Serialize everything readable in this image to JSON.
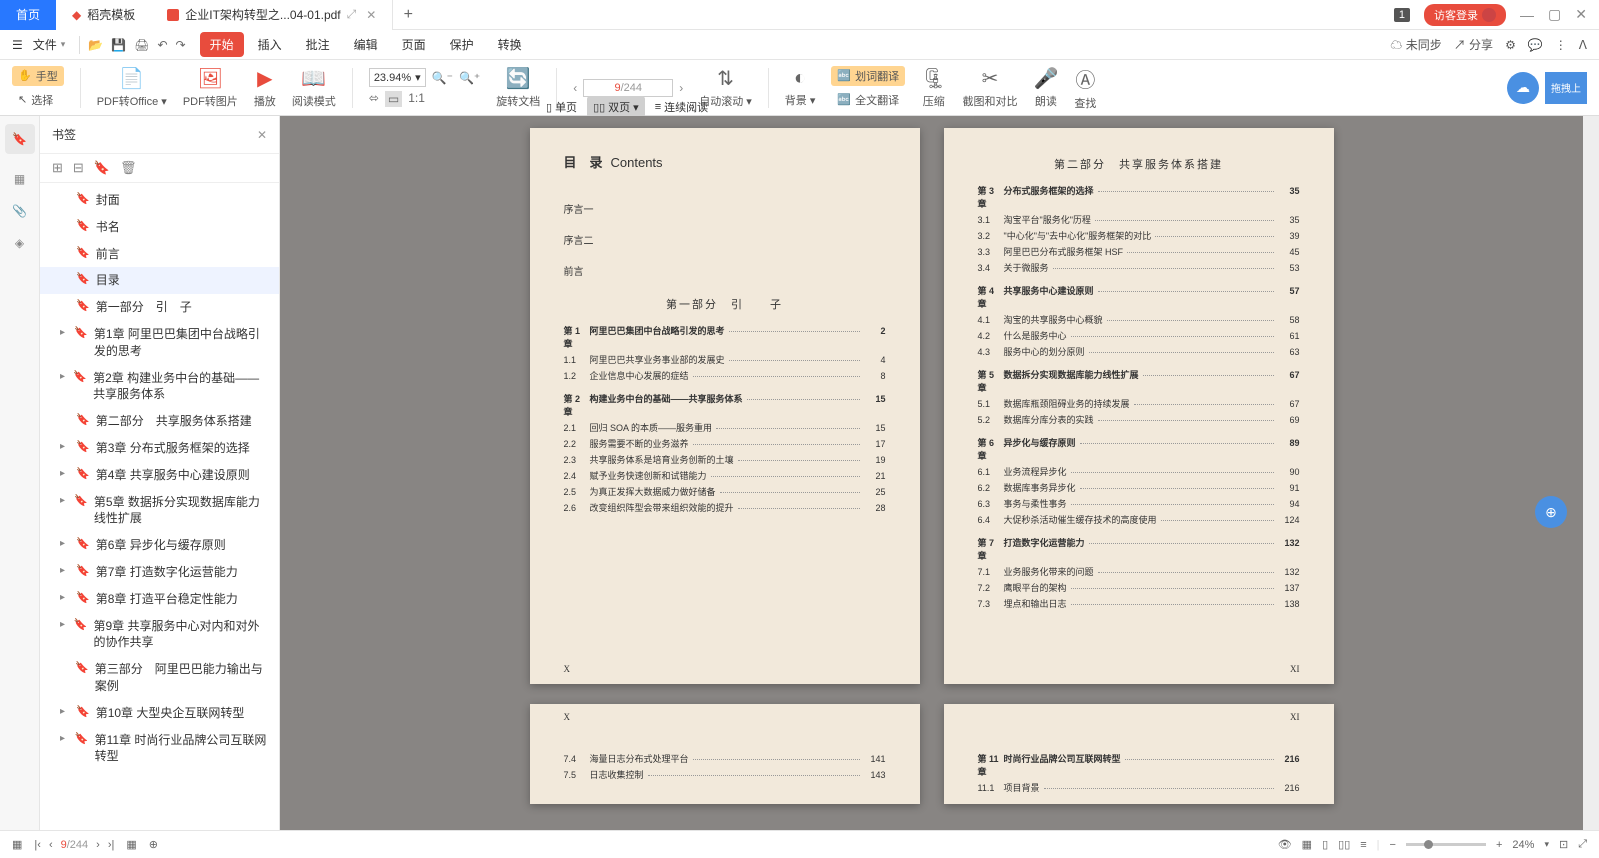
{
  "tabs": {
    "home": "首页",
    "template": "稻壳模板",
    "doc": "企业IT架构转型之...04-01.pdf"
  },
  "title_right": {
    "badge": "1",
    "login": "访客登录"
  },
  "menu": {
    "file": "文件",
    "tabs": [
      "开始",
      "插入",
      "批注",
      "编辑",
      "页面",
      "保护",
      "转换"
    ],
    "sync": "未同步",
    "share": "分享"
  },
  "ribbon": {
    "hand": "手型",
    "select": "选择",
    "pdf2office": "PDF转Office",
    "pdf2img": "PDF转图片",
    "play": "播放",
    "readmode": "阅读模式",
    "zoom": "23.94%",
    "rotate": "旋转文档",
    "single": "单页",
    "double": "双页",
    "continuous": "连续阅读",
    "autoscroll": "自动滚动",
    "bg": "背景",
    "seltrans": "划词翻译",
    "fulltrans": "全文翻译",
    "compress": "压缩",
    "crop": "截图和对比",
    "read": "朗读",
    "find": "查找",
    "curpage": "9",
    "totalpage": "/244",
    "drag": "拖拽上"
  },
  "sidebar": {
    "title": "书签",
    "items": [
      {
        "t": "封面",
        "l": 1
      },
      {
        "t": "书名",
        "l": 1
      },
      {
        "t": "前言",
        "l": 1
      },
      {
        "t": "目录",
        "l": 1,
        "active": true
      },
      {
        "t": "第一部分　引　子",
        "l": 1
      },
      {
        "t": "第1章 阿里巴巴集团中台战略引发的思考",
        "l": 2,
        "a": true
      },
      {
        "t": "第2章 构建业务中台的基础——共享服务体系",
        "l": 2,
        "a": true
      },
      {
        "t": "第二部分　共享服务体系搭建",
        "l": 1
      },
      {
        "t": "第3章 分布式服务框架的选择",
        "l": 2,
        "a": true
      },
      {
        "t": "第4章 共享服务中心建设原则",
        "l": 2,
        "a": true
      },
      {
        "t": "第5章 数据拆分实现数据库能力线性扩展",
        "l": 2,
        "a": true
      },
      {
        "t": "第6章 异步化与缓存原则",
        "l": 2,
        "a": true
      },
      {
        "t": "第7章 打造数字化运营能力",
        "l": 2,
        "a": true
      },
      {
        "t": "第8章 打造平台稳定性能力",
        "l": 2,
        "a": true
      },
      {
        "t": "第9章 共享服务中心对内和对外的协作共享",
        "l": 2,
        "a": true
      },
      {
        "t": "第三部分　阿里巴巴能力输出与案例",
        "l": 1
      },
      {
        "t": "第10章 大型央企互联网转型",
        "l": 2,
        "a": true
      },
      {
        "t": "第11章 时尚行业品牌公司互联网转型",
        "l": 2,
        "a": true
      }
    ]
  },
  "toc_left": {
    "title": "目　录",
    "title_en": "Contents",
    "pre": [
      "序言一",
      "序言二",
      "前言"
    ],
    "part": "第一部分　引　　子",
    "lines": [
      {
        "ch": true,
        "n": "第 1 章",
        "t": "阿里巴巴集团中台战略引发的思考",
        "p": "2"
      },
      {
        "n": "1.1",
        "t": "阿里巴巴共享业务事业部的发展史",
        "p": "4"
      },
      {
        "n": "1.2",
        "t": "企业信息中心发展的症结",
        "p": "8"
      },
      {
        "ch": true,
        "n": "第 2 章",
        "t": "构建业务中台的基础——共享服务体系",
        "p": "15"
      },
      {
        "n": "2.1",
        "t": "回归 SOA 的本质——服务重用",
        "p": "15"
      },
      {
        "n": "2.2",
        "t": "服务需要不断的业务滋养",
        "p": "17"
      },
      {
        "n": "2.3",
        "t": "共享服务体系是培育业务创新的土壤",
        "p": "19"
      },
      {
        "n": "2.4",
        "t": "赋予业务快速创新和试错能力",
        "p": "21"
      },
      {
        "n": "2.5",
        "t": "为真正发挥大数据威力做好储备",
        "p": "25"
      },
      {
        "n": "2.6",
        "t": "改变组织阵型会带来组织效能的提升",
        "p": "28"
      }
    ],
    "pgn": "X"
  },
  "toc_right": {
    "part": "第二部分　共享服务体系搭建",
    "lines": [
      {
        "ch": true,
        "n": "第 3 章",
        "t": "分布式服务框架的选择",
        "p": "35"
      },
      {
        "n": "3.1",
        "t": "淘宝平台\"服务化\"历程",
        "p": "35"
      },
      {
        "n": "3.2",
        "t": "\"中心化\"与\"去中心化\"服务框架的对比",
        "p": "39"
      },
      {
        "n": "3.3",
        "t": "阿里巴巴分布式服务框架 HSF",
        "p": "45"
      },
      {
        "n": "3.4",
        "t": "关于微服务",
        "p": "53"
      },
      {
        "ch": true,
        "n": "第 4 章",
        "t": "共享服务中心建设原则",
        "p": "57"
      },
      {
        "n": "4.1",
        "t": "淘宝的共享服务中心概貌",
        "p": "58"
      },
      {
        "n": "4.2",
        "t": "什么是服务中心",
        "p": "61"
      },
      {
        "n": "4.3",
        "t": "服务中心的划分原则",
        "p": "63"
      },
      {
        "ch": true,
        "n": "第 5 章",
        "t": "数据拆分实现数据库能力线性扩展",
        "p": "67"
      },
      {
        "n": "5.1",
        "t": "数据库瓶颈阻碍业务的持续发展",
        "p": "67"
      },
      {
        "n": "5.2",
        "t": "数据库分库分表的实践",
        "p": "69"
      },
      {
        "ch": true,
        "n": "第 6 章",
        "t": "异步化与缓存原则",
        "p": "89"
      },
      {
        "n": "6.1",
        "t": "业务流程异步化",
        "p": "90"
      },
      {
        "n": "6.2",
        "t": "数据库事务异步化",
        "p": "91"
      },
      {
        "n": "6.3",
        "t": "事务与柔性事务",
        "p": "94"
      },
      {
        "n": "6.4",
        "t": "大促秒杀活动催生缓存技术的高度使用",
        "p": "124"
      },
      {
        "ch": true,
        "n": "第 7 章",
        "t": "打造数字化运营能力",
        "p": "132"
      },
      {
        "n": "7.1",
        "t": "业务服务化带来的问题",
        "p": "132"
      },
      {
        "n": "7.2",
        "t": "鹰眼平台的架构",
        "p": "137"
      },
      {
        "n": "7.3",
        "t": "埋点和输出日志",
        "p": "138"
      }
    ],
    "pgn": "XI"
  },
  "toc_bl": {
    "pgn": "X",
    "lines": [
      {
        "n": "7.4",
        "t": "海量日志分布式处理平台",
        "p": "141"
      },
      {
        "n": "7.5",
        "t": "日志收集控制",
        "p": "143"
      }
    ]
  },
  "toc_br": {
    "pgn": "XI",
    "lines": [
      {
        "ch": true,
        "n": "第 11 章",
        "t": "时尚行业品牌公司互联网转型",
        "p": "216"
      },
      {
        "n": "11.1",
        "t": "项目背景",
        "p": "216"
      }
    ]
  },
  "status": {
    "page": "9",
    "total": "/244",
    "zoom": "24%"
  }
}
